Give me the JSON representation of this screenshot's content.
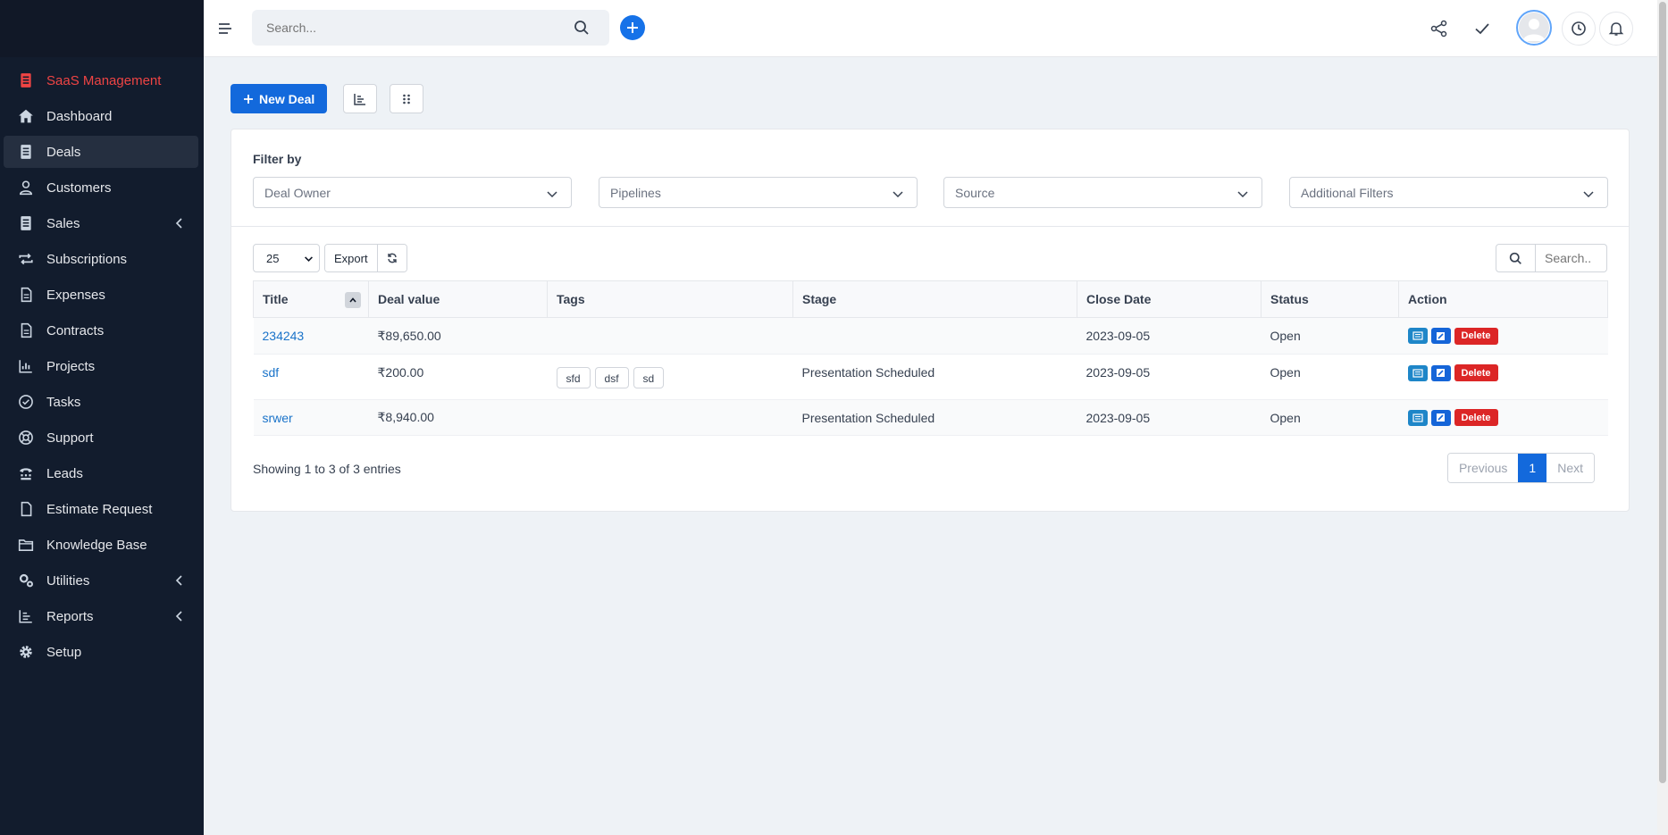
{
  "sidebar": {
    "items": [
      {
        "label": "SaaS Management",
        "icon": "document-icon"
      },
      {
        "label": "Dashboard",
        "icon": "home-icon"
      },
      {
        "label": "Deals",
        "icon": "document-icon"
      },
      {
        "label": "Customers",
        "icon": "user-icon"
      },
      {
        "label": "Sales",
        "icon": "document-icon"
      },
      {
        "label": "Subscriptions",
        "icon": "repeat-icon"
      },
      {
        "label": "Expenses",
        "icon": "file-icon"
      },
      {
        "label": "Contracts",
        "icon": "file-icon"
      },
      {
        "label": "Projects",
        "icon": "chart-icon"
      },
      {
        "label": "Tasks",
        "icon": "check-circle-icon"
      },
      {
        "label": "Support",
        "icon": "lifebuoy-icon"
      },
      {
        "label": "Leads",
        "icon": "tty-icon"
      },
      {
        "label": "Estimate Request",
        "icon": "file-icon"
      },
      {
        "label": "Knowledge Base",
        "icon": "folder-icon"
      },
      {
        "label": "Utilities",
        "icon": "cogs-icon"
      },
      {
        "label": "Reports",
        "icon": "chart-icon"
      },
      {
        "label": "Setup",
        "icon": "gear-icon"
      }
    ]
  },
  "topbar": {
    "search_placeholder": "Search..."
  },
  "toolbar": {
    "new_deal_label": "New Deal"
  },
  "filters": {
    "title": "Filter by",
    "deal_owner": "Deal Owner",
    "pipelines": "Pipelines",
    "source": "Source",
    "additional": "Additional Filters"
  },
  "table_controls": {
    "page_length": "25",
    "export_label": "Export",
    "search_placeholder": "Search.."
  },
  "table": {
    "columns": [
      "Title",
      "Deal value",
      "Tags",
      "Stage",
      "Close Date",
      "Status",
      "Action"
    ],
    "rows": [
      {
        "title": "234243",
        "value": "₹89,650.00",
        "tags": [],
        "stage": "",
        "close_date": "2023-09-05",
        "status": "Open"
      },
      {
        "title": "sdf",
        "value": "₹200.00",
        "tags": [
          "sfd",
          "dsf",
          "sd"
        ],
        "stage": "Presentation Scheduled",
        "close_date": "2023-09-05",
        "status": "Open"
      },
      {
        "title": "srwer",
        "value": "₹8,940.00",
        "tags": [],
        "stage": "Presentation Scheduled",
        "close_date": "2023-09-05",
        "status": "Open"
      }
    ],
    "delete_label": "Delete"
  },
  "footer": {
    "info": "Showing 1 to 3 of 3 entries",
    "previous": "Previous",
    "current_page": "1",
    "next": "Next"
  },
  "colors": {
    "sidebar_bg": "#121c2d",
    "accent": "#1369dc",
    "brand_red": "#ef4444",
    "delete_red": "#dc2626"
  }
}
